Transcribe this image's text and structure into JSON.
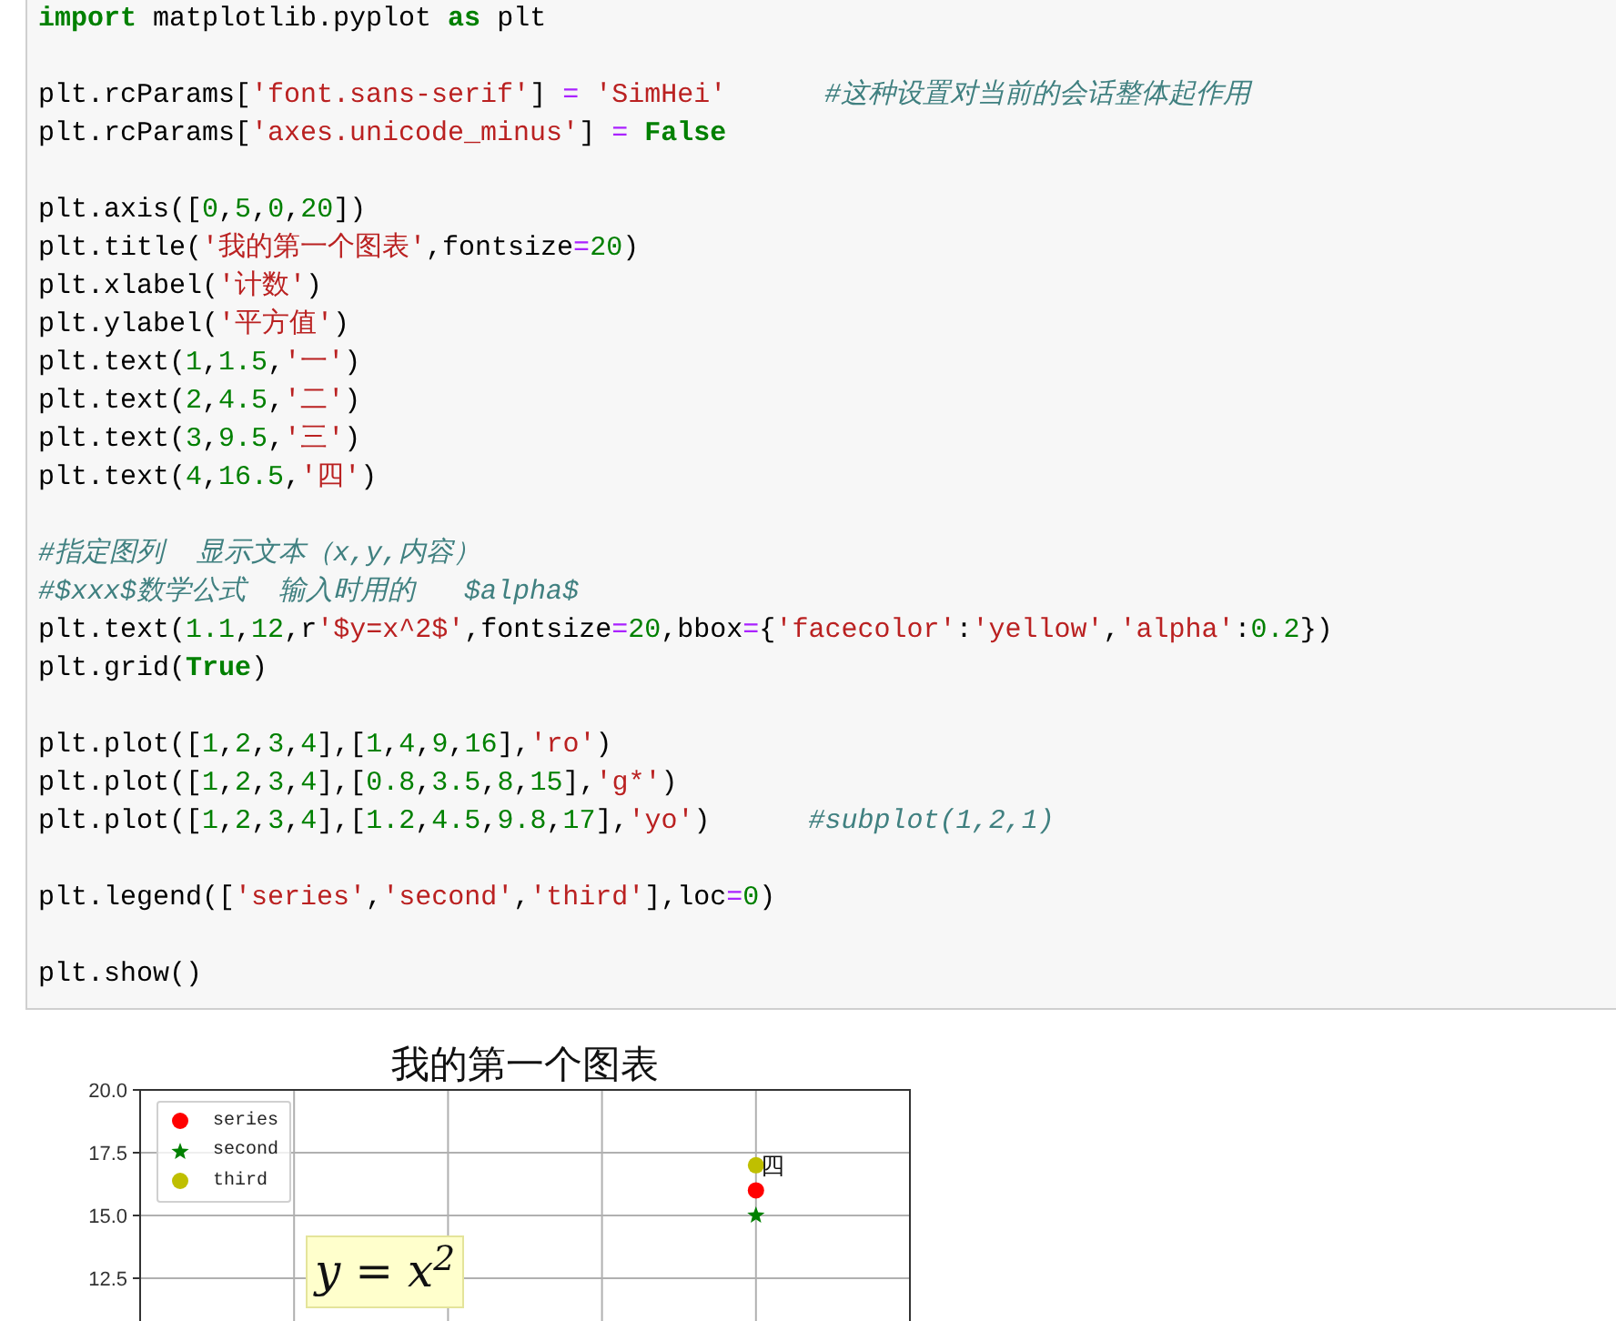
{
  "code_cell": {
    "blocks": [
      [
        [
          {
            "kind": "kw",
            "text": "import"
          },
          {
            "kind": "plain",
            "text": " matplotlib.pyplot "
          },
          {
            "kind": "kw",
            "text": "as"
          },
          {
            "kind": "plain",
            "text": " plt"
          }
        ]
      ],
      [
        [
          {
            "kind": "plain",
            "text": "plt.rcParams["
          },
          {
            "kind": "str",
            "text": "'font.sans-serif'"
          },
          {
            "kind": "plain",
            "text": "] "
          },
          {
            "kind": "op",
            "text": "="
          },
          {
            "kind": "str",
            "text": " 'SimHei'"
          },
          {
            "kind": "cm",
            "text": "      #这种设置对当前的会话整体起作用"
          }
        ],
        [
          {
            "kind": "plain",
            "text": "plt.rcParams["
          },
          {
            "kind": "str",
            "text": "'axes.unicode_minus'"
          },
          {
            "kind": "plain",
            "text": "] "
          },
          {
            "kind": "op",
            "text": "="
          },
          {
            "kind": "kw",
            "text": " False"
          }
        ]
      ],
      [
        [
          {
            "kind": "plain",
            "text": "plt.axis(["
          },
          {
            "kind": "num",
            "text": "0"
          },
          {
            "kind": "plain",
            "text": ","
          },
          {
            "kind": "num",
            "text": "5"
          },
          {
            "kind": "plain",
            "text": ","
          },
          {
            "kind": "num",
            "text": "0"
          },
          {
            "kind": "plain",
            "text": ","
          },
          {
            "kind": "num",
            "text": "20"
          },
          {
            "kind": "plain",
            "text": "])"
          }
        ],
        [
          {
            "kind": "plain",
            "text": "plt.title("
          },
          {
            "kind": "str",
            "text": "'我的第一个图表'"
          },
          {
            "kind": "plain",
            "text": ",fontsize"
          },
          {
            "kind": "op",
            "text": "="
          },
          {
            "kind": "num",
            "text": "20"
          },
          {
            "kind": "plain",
            "text": ")"
          }
        ],
        [
          {
            "kind": "plain",
            "text": "plt.xlabel("
          },
          {
            "kind": "str",
            "text": "'计数'"
          },
          {
            "kind": "plain",
            "text": ")"
          }
        ],
        [
          {
            "kind": "plain",
            "text": "plt.ylabel("
          },
          {
            "kind": "str",
            "text": "'平方值'"
          },
          {
            "kind": "plain",
            "text": ")"
          }
        ],
        [
          {
            "kind": "plain",
            "text": "plt.text("
          },
          {
            "kind": "num",
            "text": "1"
          },
          {
            "kind": "plain",
            "text": ","
          },
          {
            "kind": "num",
            "text": "1.5"
          },
          {
            "kind": "plain",
            "text": ","
          },
          {
            "kind": "str",
            "text": "'一'"
          },
          {
            "kind": "plain",
            "text": ")"
          }
        ],
        [
          {
            "kind": "plain",
            "text": "plt.text("
          },
          {
            "kind": "num",
            "text": "2"
          },
          {
            "kind": "plain",
            "text": ","
          },
          {
            "kind": "num",
            "text": "4.5"
          },
          {
            "kind": "plain",
            "text": ","
          },
          {
            "kind": "str",
            "text": "'二'"
          },
          {
            "kind": "plain",
            "text": ")"
          }
        ],
        [
          {
            "kind": "plain",
            "text": "plt.text("
          },
          {
            "kind": "num",
            "text": "3"
          },
          {
            "kind": "plain",
            "text": ","
          },
          {
            "kind": "num",
            "text": "9.5"
          },
          {
            "kind": "plain",
            "text": ","
          },
          {
            "kind": "str",
            "text": "'三'"
          },
          {
            "kind": "plain",
            "text": ")"
          }
        ],
        [
          {
            "kind": "plain",
            "text": "plt.text("
          },
          {
            "kind": "num",
            "text": "4"
          },
          {
            "kind": "plain",
            "text": ","
          },
          {
            "kind": "num",
            "text": "16.5"
          },
          {
            "kind": "plain",
            "text": ","
          },
          {
            "kind": "str",
            "text": "'四'"
          },
          {
            "kind": "plain",
            "text": ")"
          }
        ]
      ],
      [
        [
          {
            "kind": "cm",
            "text": "#指定图列  显示文本（x,y,内容）"
          }
        ],
        [
          {
            "kind": "cm",
            "text": "#$xxx$数学公式  输入时用的   $alpha$"
          }
        ],
        [
          {
            "kind": "plain",
            "text": "plt.text("
          },
          {
            "kind": "num",
            "text": "1.1"
          },
          {
            "kind": "plain",
            "text": ","
          },
          {
            "kind": "num",
            "text": "12"
          },
          {
            "kind": "plain",
            "text": ",r"
          },
          {
            "kind": "str",
            "text": "'$y=x^2$'"
          },
          {
            "kind": "plain",
            "text": ",fontsize"
          },
          {
            "kind": "op",
            "text": "="
          },
          {
            "kind": "num",
            "text": "20"
          },
          {
            "kind": "plain",
            "text": ",bbox"
          },
          {
            "kind": "op",
            "text": "="
          },
          {
            "kind": "plain",
            "text": "{"
          },
          {
            "kind": "str",
            "text": "'facecolor'"
          },
          {
            "kind": "plain",
            "text": ":"
          },
          {
            "kind": "str",
            "text": "'yellow'"
          },
          {
            "kind": "plain",
            "text": ","
          },
          {
            "kind": "str",
            "text": "'alpha'"
          },
          {
            "kind": "plain",
            "text": ":"
          },
          {
            "kind": "num",
            "text": "0.2"
          },
          {
            "kind": "plain",
            "text": "})"
          }
        ],
        [
          {
            "kind": "plain",
            "text": "plt.grid("
          },
          {
            "kind": "kw",
            "text": "True"
          },
          {
            "kind": "plain",
            "text": ")"
          }
        ]
      ],
      [
        [
          {
            "kind": "plain",
            "text": "plt.plot(["
          },
          {
            "kind": "num",
            "text": "1"
          },
          {
            "kind": "plain",
            "text": ","
          },
          {
            "kind": "num",
            "text": "2"
          },
          {
            "kind": "plain",
            "text": ","
          },
          {
            "kind": "num",
            "text": "3"
          },
          {
            "kind": "plain",
            "text": ","
          },
          {
            "kind": "num",
            "text": "4"
          },
          {
            "kind": "plain",
            "text": "],["
          },
          {
            "kind": "num",
            "text": "1"
          },
          {
            "kind": "plain",
            "text": ","
          },
          {
            "kind": "num",
            "text": "4"
          },
          {
            "kind": "plain",
            "text": ","
          },
          {
            "kind": "num",
            "text": "9"
          },
          {
            "kind": "plain",
            "text": ","
          },
          {
            "kind": "num",
            "text": "16"
          },
          {
            "kind": "plain",
            "text": "],"
          },
          {
            "kind": "str",
            "text": "'ro'"
          },
          {
            "kind": "plain",
            "text": ")"
          }
        ],
        [
          {
            "kind": "plain",
            "text": "plt.plot(["
          },
          {
            "kind": "num",
            "text": "1"
          },
          {
            "kind": "plain",
            "text": ","
          },
          {
            "kind": "num",
            "text": "2"
          },
          {
            "kind": "plain",
            "text": ","
          },
          {
            "kind": "num",
            "text": "3"
          },
          {
            "kind": "plain",
            "text": ","
          },
          {
            "kind": "num",
            "text": "4"
          },
          {
            "kind": "plain",
            "text": "],["
          },
          {
            "kind": "num",
            "text": "0.8"
          },
          {
            "kind": "plain",
            "text": ","
          },
          {
            "kind": "num",
            "text": "3.5"
          },
          {
            "kind": "plain",
            "text": ","
          },
          {
            "kind": "num",
            "text": "8"
          },
          {
            "kind": "plain",
            "text": ","
          },
          {
            "kind": "num",
            "text": "15"
          },
          {
            "kind": "plain",
            "text": "],"
          },
          {
            "kind": "str",
            "text": "'g*'"
          },
          {
            "kind": "plain",
            "text": ")"
          }
        ],
        [
          {
            "kind": "plain",
            "text": "plt.plot(["
          },
          {
            "kind": "num",
            "text": "1"
          },
          {
            "kind": "plain",
            "text": ","
          },
          {
            "kind": "num",
            "text": "2"
          },
          {
            "kind": "plain",
            "text": ","
          },
          {
            "kind": "num",
            "text": "3"
          },
          {
            "kind": "plain",
            "text": ","
          },
          {
            "kind": "num",
            "text": "4"
          },
          {
            "kind": "plain",
            "text": "],["
          },
          {
            "kind": "num",
            "text": "1.2"
          },
          {
            "kind": "plain",
            "text": ","
          },
          {
            "kind": "num",
            "text": "4.5"
          },
          {
            "kind": "plain",
            "text": ","
          },
          {
            "kind": "num",
            "text": "9.8"
          },
          {
            "kind": "plain",
            "text": ","
          },
          {
            "kind": "num",
            "text": "17"
          },
          {
            "kind": "plain",
            "text": "],"
          },
          {
            "kind": "str",
            "text": "'yo'"
          },
          {
            "kind": "plain",
            "text": ")      "
          },
          {
            "kind": "cm",
            "text": "#subplot(1,2,1)"
          }
        ]
      ],
      [
        [
          {
            "kind": "plain",
            "text": "plt.legend(["
          },
          {
            "kind": "str",
            "text": "'series'"
          },
          {
            "kind": "plain",
            "text": ","
          },
          {
            "kind": "str",
            "text": "'second'"
          },
          {
            "kind": "plain",
            "text": ","
          },
          {
            "kind": "str",
            "text": "'third'"
          },
          {
            "kind": "plain",
            "text": "],loc"
          },
          {
            "kind": "op",
            "text": "="
          },
          {
            "kind": "num",
            "text": "0"
          },
          {
            "kind": "plain",
            "text": ")"
          }
        ]
      ],
      [
        [
          {
            "kind": "plain",
            "text": "plt.show()"
          }
        ]
      ]
    ]
  },
  "output": {
    "chart_data": {
      "type": "scatter",
      "title": "我的第一个图表",
      "categories": [
        null,
        null,
        null,
        null
      ],
      "ylim": [
        0,
        20
      ],
      "grid": true,
      "legend": true,
      "yticks": [
        {
          "value": 12.5,
          "label": "12.5"
        },
        {
          "value": 15,
          "label": "15.0"
        },
        {
          "value": 17.5,
          "label": "17.5"
        },
        {
          "value": 20,
          "label": "20.0"
        }
      ],
      "series": [
        {
          "name": "series",
          "color": "#ff0000",
          "marker": "circle",
          "values": [
            null,
            null,
            null,
            16
          ]
        },
        {
          "name": "second",
          "color": "#008000",
          "marker": "star",
          "values": [
            null,
            null,
            null,
            15
          ]
        },
        {
          "name": "third",
          "color": "#bfbf00",
          "marker": "circle",
          "values": [
            null,
            null,
            null,
            17
          ]
        }
      ]
    },
    "text_labels": [
      {
        "text": "四",
        "boxed": false
      },
      {
        "text": "y = x$^{2}$",
        "boxed": true
      }
    ]
  }
}
